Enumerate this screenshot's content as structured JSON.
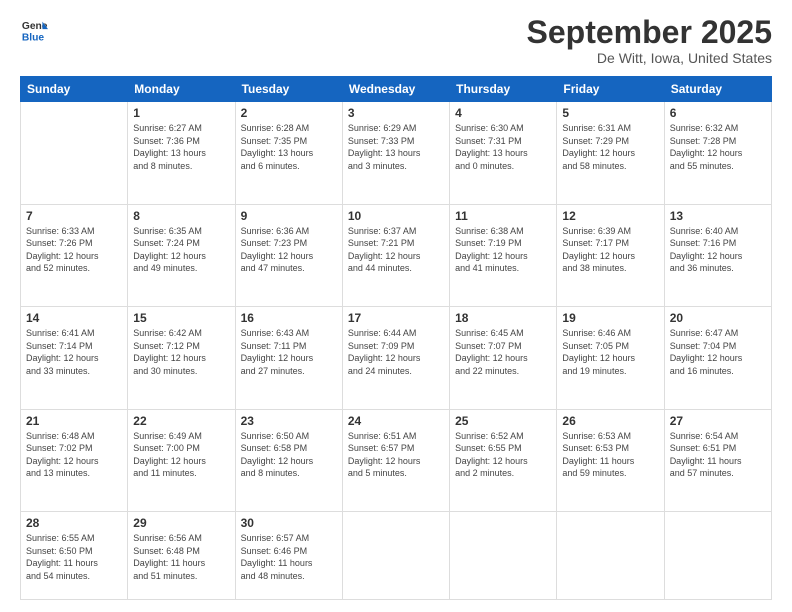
{
  "header": {
    "logo_general": "General",
    "logo_blue": "Blue",
    "month_title": "September 2025",
    "location": "De Witt, Iowa, United States"
  },
  "days_of_week": [
    "Sunday",
    "Monday",
    "Tuesday",
    "Wednesday",
    "Thursday",
    "Friday",
    "Saturday"
  ],
  "weeks": [
    [
      {
        "day": "",
        "info": ""
      },
      {
        "day": "1",
        "info": "Sunrise: 6:27 AM\nSunset: 7:36 PM\nDaylight: 13 hours\nand 8 minutes."
      },
      {
        "day": "2",
        "info": "Sunrise: 6:28 AM\nSunset: 7:35 PM\nDaylight: 13 hours\nand 6 minutes."
      },
      {
        "day": "3",
        "info": "Sunrise: 6:29 AM\nSunset: 7:33 PM\nDaylight: 13 hours\nand 3 minutes."
      },
      {
        "day": "4",
        "info": "Sunrise: 6:30 AM\nSunset: 7:31 PM\nDaylight: 13 hours\nand 0 minutes."
      },
      {
        "day": "5",
        "info": "Sunrise: 6:31 AM\nSunset: 7:29 PM\nDaylight: 12 hours\nand 58 minutes."
      },
      {
        "day": "6",
        "info": "Sunrise: 6:32 AM\nSunset: 7:28 PM\nDaylight: 12 hours\nand 55 minutes."
      }
    ],
    [
      {
        "day": "7",
        "info": "Sunrise: 6:33 AM\nSunset: 7:26 PM\nDaylight: 12 hours\nand 52 minutes."
      },
      {
        "day": "8",
        "info": "Sunrise: 6:35 AM\nSunset: 7:24 PM\nDaylight: 12 hours\nand 49 minutes."
      },
      {
        "day": "9",
        "info": "Sunrise: 6:36 AM\nSunset: 7:23 PM\nDaylight: 12 hours\nand 47 minutes."
      },
      {
        "day": "10",
        "info": "Sunrise: 6:37 AM\nSunset: 7:21 PM\nDaylight: 12 hours\nand 44 minutes."
      },
      {
        "day": "11",
        "info": "Sunrise: 6:38 AM\nSunset: 7:19 PM\nDaylight: 12 hours\nand 41 minutes."
      },
      {
        "day": "12",
        "info": "Sunrise: 6:39 AM\nSunset: 7:17 PM\nDaylight: 12 hours\nand 38 minutes."
      },
      {
        "day": "13",
        "info": "Sunrise: 6:40 AM\nSunset: 7:16 PM\nDaylight: 12 hours\nand 36 minutes."
      }
    ],
    [
      {
        "day": "14",
        "info": "Sunrise: 6:41 AM\nSunset: 7:14 PM\nDaylight: 12 hours\nand 33 minutes."
      },
      {
        "day": "15",
        "info": "Sunrise: 6:42 AM\nSunset: 7:12 PM\nDaylight: 12 hours\nand 30 minutes."
      },
      {
        "day": "16",
        "info": "Sunrise: 6:43 AM\nSunset: 7:11 PM\nDaylight: 12 hours\nand 27 minutes."
      },
      {
        "day": "17",
        "info": "Sunrise: 6:44 AM\nSunset: 7:09 PM\nDaylight: 12 hours\nand 24 minutes."
      },
      {
        "day": "18",
        "info": "Sunrise: 6:45 AM\nSunset: 7:07 PM\nDaylight: 12 hours\nand 22 minutes."
      },
      {
        "day": "19",
        "info": "Sunrise: 6:46 AM\nSunset: 7:05 PM\nDaylight: 12 hours\nand 19 minutes."
      },
      {
        "day": "20",
        "info": "Sunrise: 6:47 AM\nSunset: 7:04 PM\nDaylight: 12 hours\nand 16 minutes."
      }
    ],
    [
      {
        "day": "21",
        "info": "Sunrise: 6:48 AM\nSunset: 7:02 PM\nDaylight: 12 hours\nand 13 minutes."
      },
      {
        "day": "22",
        "info": "Sunrise: 6:49 AM\nSunset: 7:00 PM\nDaylight: 12 hours\nand 11 minutes."
      },
      {
        "day": "23",
        "info": "Sunrise: 6:50 AM\nSunset: 6:58 PM\nDaylight: 12 hours\nand 8 minutes."
      },
      {
        "day": "24",
        "info": "Sunrise: 6:51 AM\nSunset: 6:57 PM\nDaylight: 12 hours\nand 5 minutes."
      },
      {
        "day": "25",
        "info": "Sunrise: 6:52 AM\nSunset: 6:55 PM\nDaylight: 12 hours\nand 2 minutes."
      },
      {
        "day": "26",
        "info": "Sunrise: 6:53 AM\nSunset: 6:53 PM\nDaylight: 11 hours\nand 59 minutes."
      },
      {
        "day": "27",
        "info": "Sunrise: 6:54 AM\nSunset: 6:51 PM\nDaylight: 11 hours\nand 57 minutes."
      }
    ],
    [
      {
        "day": "28",
        "info": "Sunrise: 6:55 AM\nSunset: 6:50 PM\nDaylight: 11 hours\nand 54 minutes."
      },
      {
        "day": "29",
        "info": "Sunrise: 6:56 AM\nSunset: 6:48 PM\nDaylight: 11 hours\nand 51 minutes."
      },
      {
        "day": "30",
        "info": "Sunrise: 6:57 AM\nSunset: 6:46 PM\nDaylight: 11 hours\nand 48 minutes."
      },
      {
        "day": "",
        "info": ""
      },
      {
        "day": "",
        "info": ""
      },
      {
        "day": "",
        "info": ""
      },
      {
        "day": "",
        "info": ""
      }
    ]
  ]
}
